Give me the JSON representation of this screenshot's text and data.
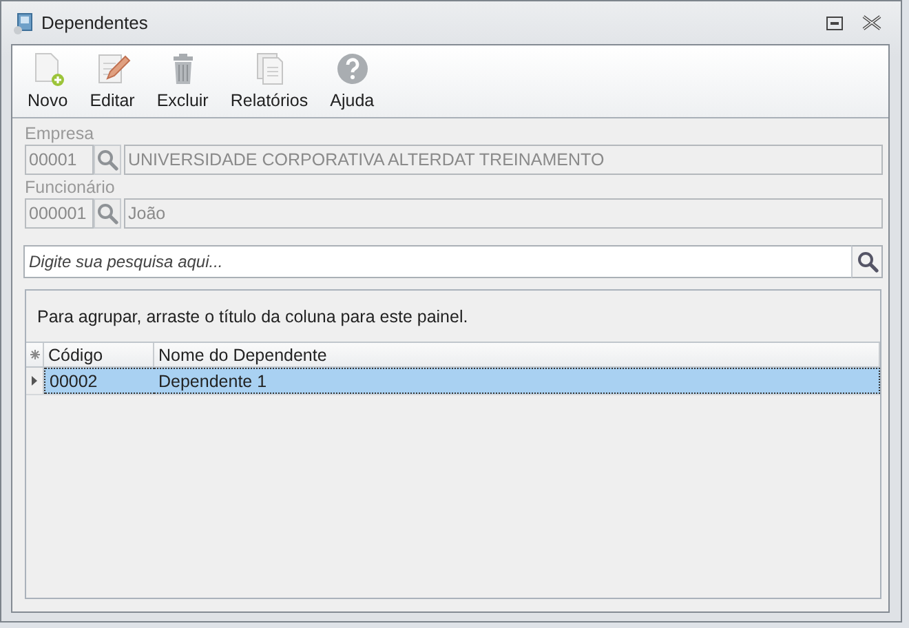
{
  "window": {
    "title": "Dependentes"
  },
  "toolbar": [
    {
      "label": "Novo",
      "kind": "new",
      "disabled": false
    },
    {
      "label": "Editar",
      "kind": "edit",
      "disabled": false
    },
    {
      "label": "Excluir",
      "kind": "delete",
      "disabled": false
    },
    {
      "label": "Relatórios",
      "kind": "reports",
      "disabled": false
    },
    {
      "label": "Ajuda",
      "kind": "help",
      "disabled": false
    }
  ],
  "lookups": [
    {
      "label": "Empresa",
      "code": "00001",
      "name": "UNIVERSIDADE CORPORATIVA ALTERDAT TREINAMENTO",
      "disabled": true
    },
    {
      "label": "Funcionário",
      "code": "000001",
      "name": "João",
      "disabled": true
    }
  ],
  "search": {
    "placeholder": "Digite sua pesquisa aqui..."
  },
  "grid": {
    "group_hint": "Para agrupar, arraste o título da coluna para este painel.",
    "columns": [
      "Código",
      "Nome do Dependente"
    ],
    "rows": [
      {
        "cells": [
          "00002",
          "Dependente 1"
        ],
        "selected": true
      }
    ]
  }
}
